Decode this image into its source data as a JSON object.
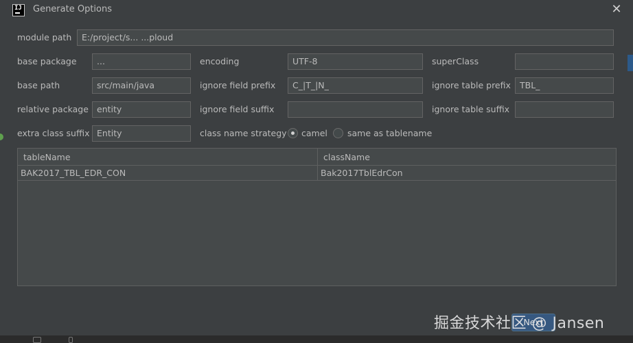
{
  "window": {
    "title": "Generate Options",
    "close_glyph": "✕",
    "logo_text": "IJ"
  },
  "form": {
    "module_path": {
      "label": "module path",
      "value": "E:/project/s... ...ploud"
    },
    "base_package": {
      "label": "base package",
      "value": "..."
    },
    "encoding": {
      "label": "encoding",
      "value": "UTF-8"
    },
    "super_class": {
      "label": "superClass",
      "value": ""
    },
    "base_path": {
      "label": "base path",
      "value": "src/main/java"
    },
    "ignore_field_prefix": {
      "label": "ignore field prefix",
      "value": "C_|T_|N_"
    },
    "ignore_table_prefix": {
      "label": "ignore table prefix",
      "value": "TBL_"
    },
    "relative_package": {
      "label": "relative package",
      "value": "entity"
    },
    "ignore_field_suffix": {
      "label": "ignore field suffix",
      "value": ""
    },
    "ignore_table_suffix": {
      "label": "ignore table suffix",
      "value": ""
    },
    "extra_class_suffix": {
      "label": "extra class suffix",
      "value": "Entity"
    },
    "class_name_strategy": {
      "label": "class name strategy",
      "options": [
        {
          "label": "camel",
          "selected": true
        },
        {
          "label": "same as tablename",
          "selected": false
        }
      ]
    }
  },
  "table": {
    "columns": [
      "tableName",
      "className"
    ],
    "rows": [
      [
        "BAK2017_TBL_EDR_CON",
        "Bak2017TblEdrCon"
      ]
    ]
  },
  "footer": {
    "next_label": "Next",
    "watermark": "掘金技术社区 @ Jansen"
  },
  "icons": {
    "logo": "intellij-logo-icon",
    "close": "close-icon",
    "gutter": "green-dot-icon"
  },
  "colors": {
    "background": "#3c3f41",
    "field_bg": "#45494a",
    "text": "#bbbbbb",
    "button_primary": "#365880"
  }
}
